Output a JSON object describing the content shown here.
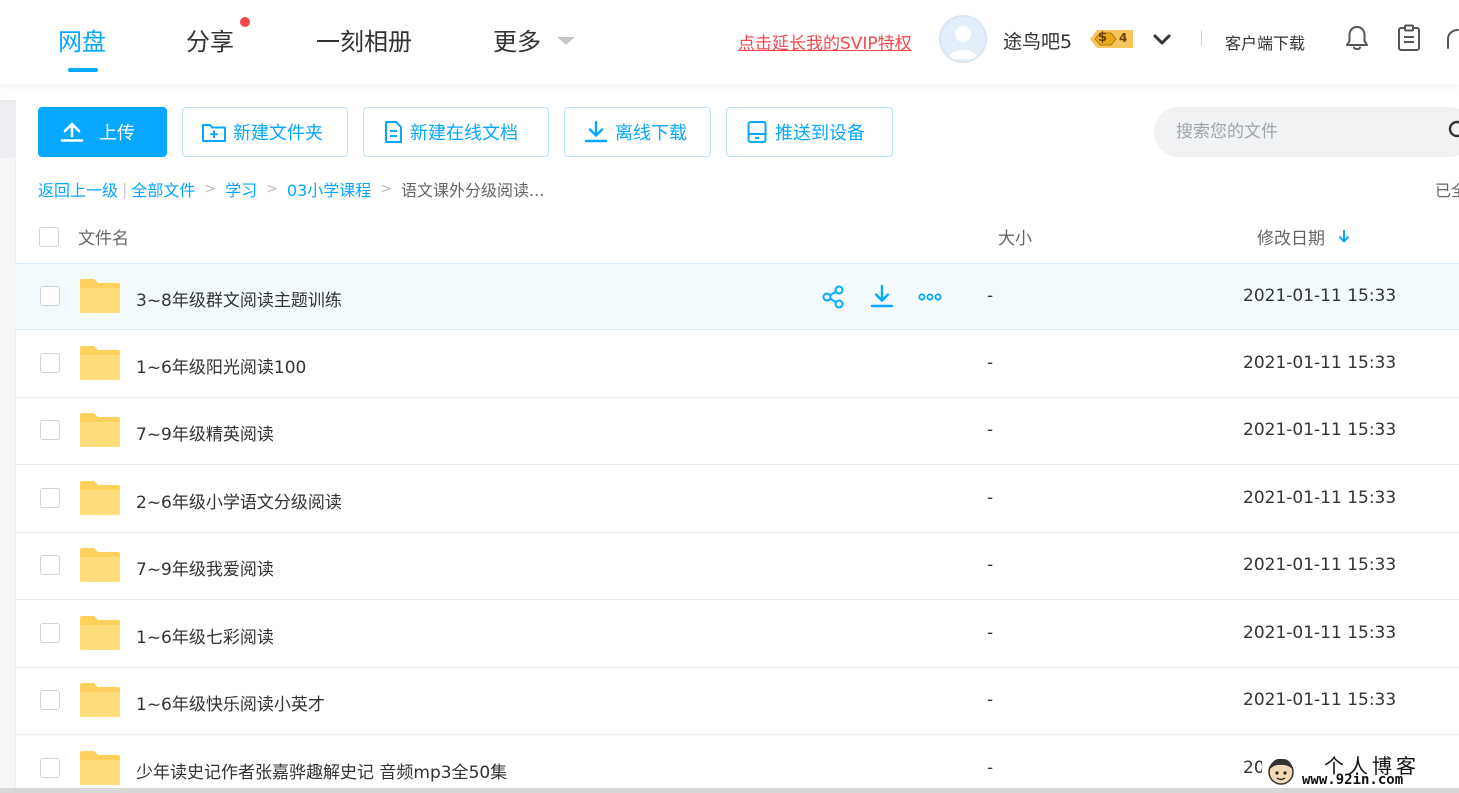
{
  "nav": {
    "tabs": [
      {
        "label": "网盘",
        "active": true
      },
      {
        "label": "分享",
        "has_dot": true
      },
      {
        "label": "一刻相册"
      },
      {
        "label": "更多"
      }
    ],
    "svip_link": "点击延长我的SVIP特权",
    "username": "途鸟吧5",
    "vip_level": "4",
    "vip_symbol": "$",
    "client_download": "客户端下载"
  },
  "toolbar": {
    "upload": "上传",
    "new_folder": "新建文件夹",
    "new_doc": "新建在线文档",
    "offline_download": "离线下载",
    "push_device": "推送到设备",
    "search_placeholder": "搜索您的文件"
  },
  "breadcrumb": {
    "back": "返回上一级",
    "items": [
      "全部文件",
      "学习",
      "03小学课程"
    ],
    "current": "语文课外分级阅读...",
    "loaded_status": "已全"
  },
  "table": {
    "headers": {
      "name": "文件名",
      "size": "大小",
      "date": "修改日期"
    },
    "sort": "date-desc",
    "rows": [
      {
        "name": "3~8年级群文阅读主题训练",
        "size": "-",
        "date": "2021-01-11 15:33"
      },
      {
        "name": "1~6年级阳光阅读100",
        "size": "-",
        "date": "2021-01-11 15:33"
      },
      {
        "name": "7~9年级精英阅读",
        "size": "-",
        "date": "2021-01-11 15:33"
      },
      {
        "name": "2~6年级小学语文分级阅读",
        "size": "-",
        "date": "2021-01-11 15:33"
      },
      {
        "name": "7~9年级我爱阅读",
        "size": "-",
        "date": "2021-01-11 15:33"
      },
      {
        "name": "1~6年级七彩阅读",
        "size": "-",
        "date": "2021-01-11 15:33"
      },
      {
        "name": "1~6年级快乐阅读小英才",
        "size": "-",
        "date": "2021-01-11 15:33"
      },
      {
        "name": "少年读史记作者张嘉骅趣解史记 音频mp3全50集",
        "size": "-",
        "date": "20"
      }
    ],
    "hover_actions": [
      "share-icon",
      "download-icon",
      "more-icon"
    ]
  },
  "watermark": {
    "text": "个人博客",
    "url": "www.92in.com"
  },
  "colors": {
    "accent": "#06a7ff",
    "danger": "#f5484d",
    "folder": "#ffd15c"
  }
}
